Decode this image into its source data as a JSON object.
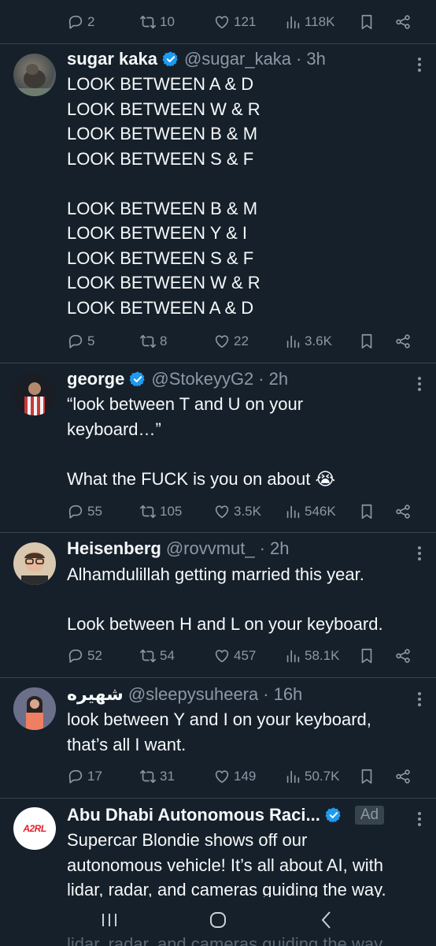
{
  "top_actions": {
    "reply": "2",
    "retweet": "10",
    "like": "121",
    "views": "118K"
  },
  "tweets": [
    {
      "name": "sugar kaka",
      "verified": true,
      "handle": "@sugar_kaka",
      "time": "3h",
      "lines": "LOOK BETWEEN A & D\nLOOK BETWEEN W & R\nLOOK BETWEEN B & M\nLOOK BETWEEN S & F\n\nLOOK BETWEEN B & M\nLOOK BETWEEN Y & I\nLOOK BETWEEN S & F\nLOOK BETWEEN W & R\nLOOK BETWEEN A & D",
      "actions": {
        "reply": "5",
        "retweet": "8",
        "like": "22",
        "views": "3.6K"
      }
    },
    {
      "name": "george",
      "verified": true,
      "handle": "@StokeyyG2",
      "time": "2h",
      "lines": "“look between T and U on your\nkeyboard…”\n\nWhat the FUCK is you on about 😭",
      "actions": {
        "reply": "55",
        "retweet": "105",
        "like": "3.5K",
        "views": "546K"
      }
    },
    {
      "name": "Heisenberg",
      "verified": false,
      "handle": "@rovvmut_",
      "time": "2h",
      "lines": "Alhamdulillah getting married this year.\n\nLook between H and L on your keyboard.",
      "actions": {
        "reply": "52",
        "retweet": "54",
        "like": "457",
        "views": "58.1K"
      }
    },
    {
      "name": "شهيره",
      "verified": false,
      "handle": "@sleepysuheera",
      "time": "16h",
      "lines": "look between Y and I on your keyboard,\nthat’s all I want.",
      "actions": {
        "reply": "17",
        "retweet": "31",
        "like": "149",
        "views": "50.7K"
      }
    },
    {
      "name": "Abu Dhabi Autonomous Raci...",
      "verified": true,
      "ad_label": "Ad",
      "logo_text": "A2RL",
      "lines": "Supercar Blondie shows off our\nautonomous vehicle! It’s all about AI, with\nlidar, radar, and cameras guiding the way."
    }
  ],
  "ghost_text": "lidar, radar, and cameras guiding the way.",
  "colors": {
    "background": "#15202b",
    "muted": "#8b98a5",
    "verified": "#1d9bf0",
    "divider": "#38444d"
  }
}
